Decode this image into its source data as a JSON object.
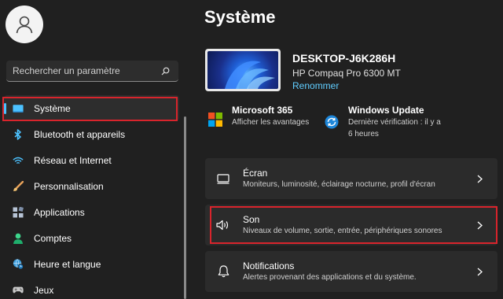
{
  "search": {
    "placeholder": "Rechercher un paramètre"
  },
  "sidebar": {
    "items": [
      {
        "label": "Système",
        "icon": "monitor-icon"
      },
      {
        "label": "Bluetooth et appareils",
        "icon": "bluetooth-icon"
      },
      {
        "label": "Réseau et Internet",
        "icon": "wifi-icon"
      },
      {
        "label": "Personnalisation",
        "icon": "brush-icon"
      },
      {
        "label": "Applications",
        "icon": "apps-icon"
      },
      {
        "label": "Comptes",
        "icon": "person-icon"
      },
      {
        "label": "Heure et langue",
        "icon": "globe-clock-icon"
      },
      {
        "label": "Jeux",
        "icon": "gamepad-icon"
      }
    ]
  },
  "main": {
    "title": "Système",
    "device": {
      "name": "DESKTOP-J6K286H",
      "model": "HP Compaq Pro 6300 MT",
      "rename": "Renommer"
    },
    "quick": [
      {
        "title": "Microsoft 365",
        "subtitle": "Afficher les avantages",
        "icon": "microsoft-logo-icon"
      },
      {
        "title": "Windows Update",
        "subtitle": "Dernière vérification : il y a 6 heures",
        "icon": "sync-icon"
      }
    ],
    "cards": [
      {
        "title": "Écran",
        "subtitle": "Moniteurs, luminosité, éclairage nocturne, profil d'écran",
        "icon": "display-icon"
      },
      {
        "title": "Son",
        "subtitle": "Niveaux de volume, sortie, entrée, périphériques sonores",
        "icon": "speaker-icon"
      },
      {
        "title": "Notifications",
        "subtitle": "Alertes provenant des applications et du système.",
        "icon": "bell-icon"
      }
    ]
  },
  "colors": {
    "background": "#202020",
    "card": "#2b2b2b",
    "accent": "#4cc2ff",
    "link": "#60cdff",
    "highlight": "#d9242c"
  }
}
